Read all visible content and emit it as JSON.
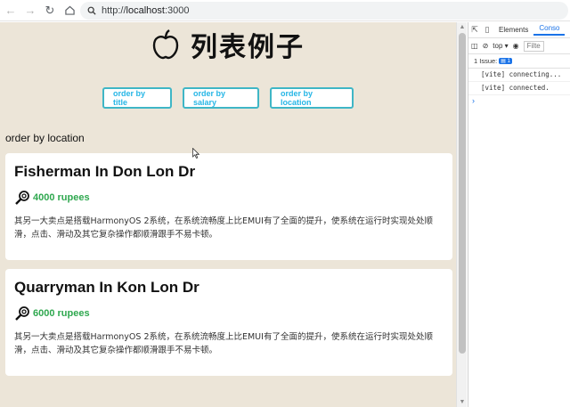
{
  "browser": {
    "url_scheme": "http://",
    "url_host": "localhost",
    "url_port": ":3000"
  },
  "header": {
    "title": "列表例子",
    "icon": "apple-icon"
  },
  "sort_buttons": {
    "title_label": "order by title",
    "salary_label": "order by salary",
    "location_label": "order by location"
  },
  "order_label": "order by location",
  "jobs": [
    {
      "title": "Fisherman In Don Lon Dr",
      "salary": "4000 rupees",
      "description": "其另一大卖点是搭载HarmonyOS 2系统，在系统流畅度上比EMUI有了全面的提升，使系统在运行时实现处处顺滑，点击、滑动及其它复杂操作都顺滑跟手不易卡顿。"
    },
    {
      "title": "Quarryman In Kon Lon Dr",
      "salary": "6000 rupees",
      "description": "其另一大卖点是搭载HarmonyOS 2系统，在系统流畅度上比EMUI有了全面的提升，使系统在运行时实现处处顺滑，点击、滑动及其它复杂操作都顺滑跟手不易卡顿。"
    }
  ],
  "devtools": {
    "tab_elements": "Elements",
    "tab_console": "Conso",
    "context": "top",
    "filter_placeholder": "Filte",
    "issues_text": "1 Issue:",
    "issues_count": "1",
    "logs": [
      "[vite] connecting...",
      "[vite] connected."
    ],
    "prompt": "›"
  },
  "colors": {
    "app_background": "#ece5d8",
    "button_border": "#3fb6c6",
    "button_text": "#26b6e6",
    "salary_text": "#2fa84f"
  }
}
